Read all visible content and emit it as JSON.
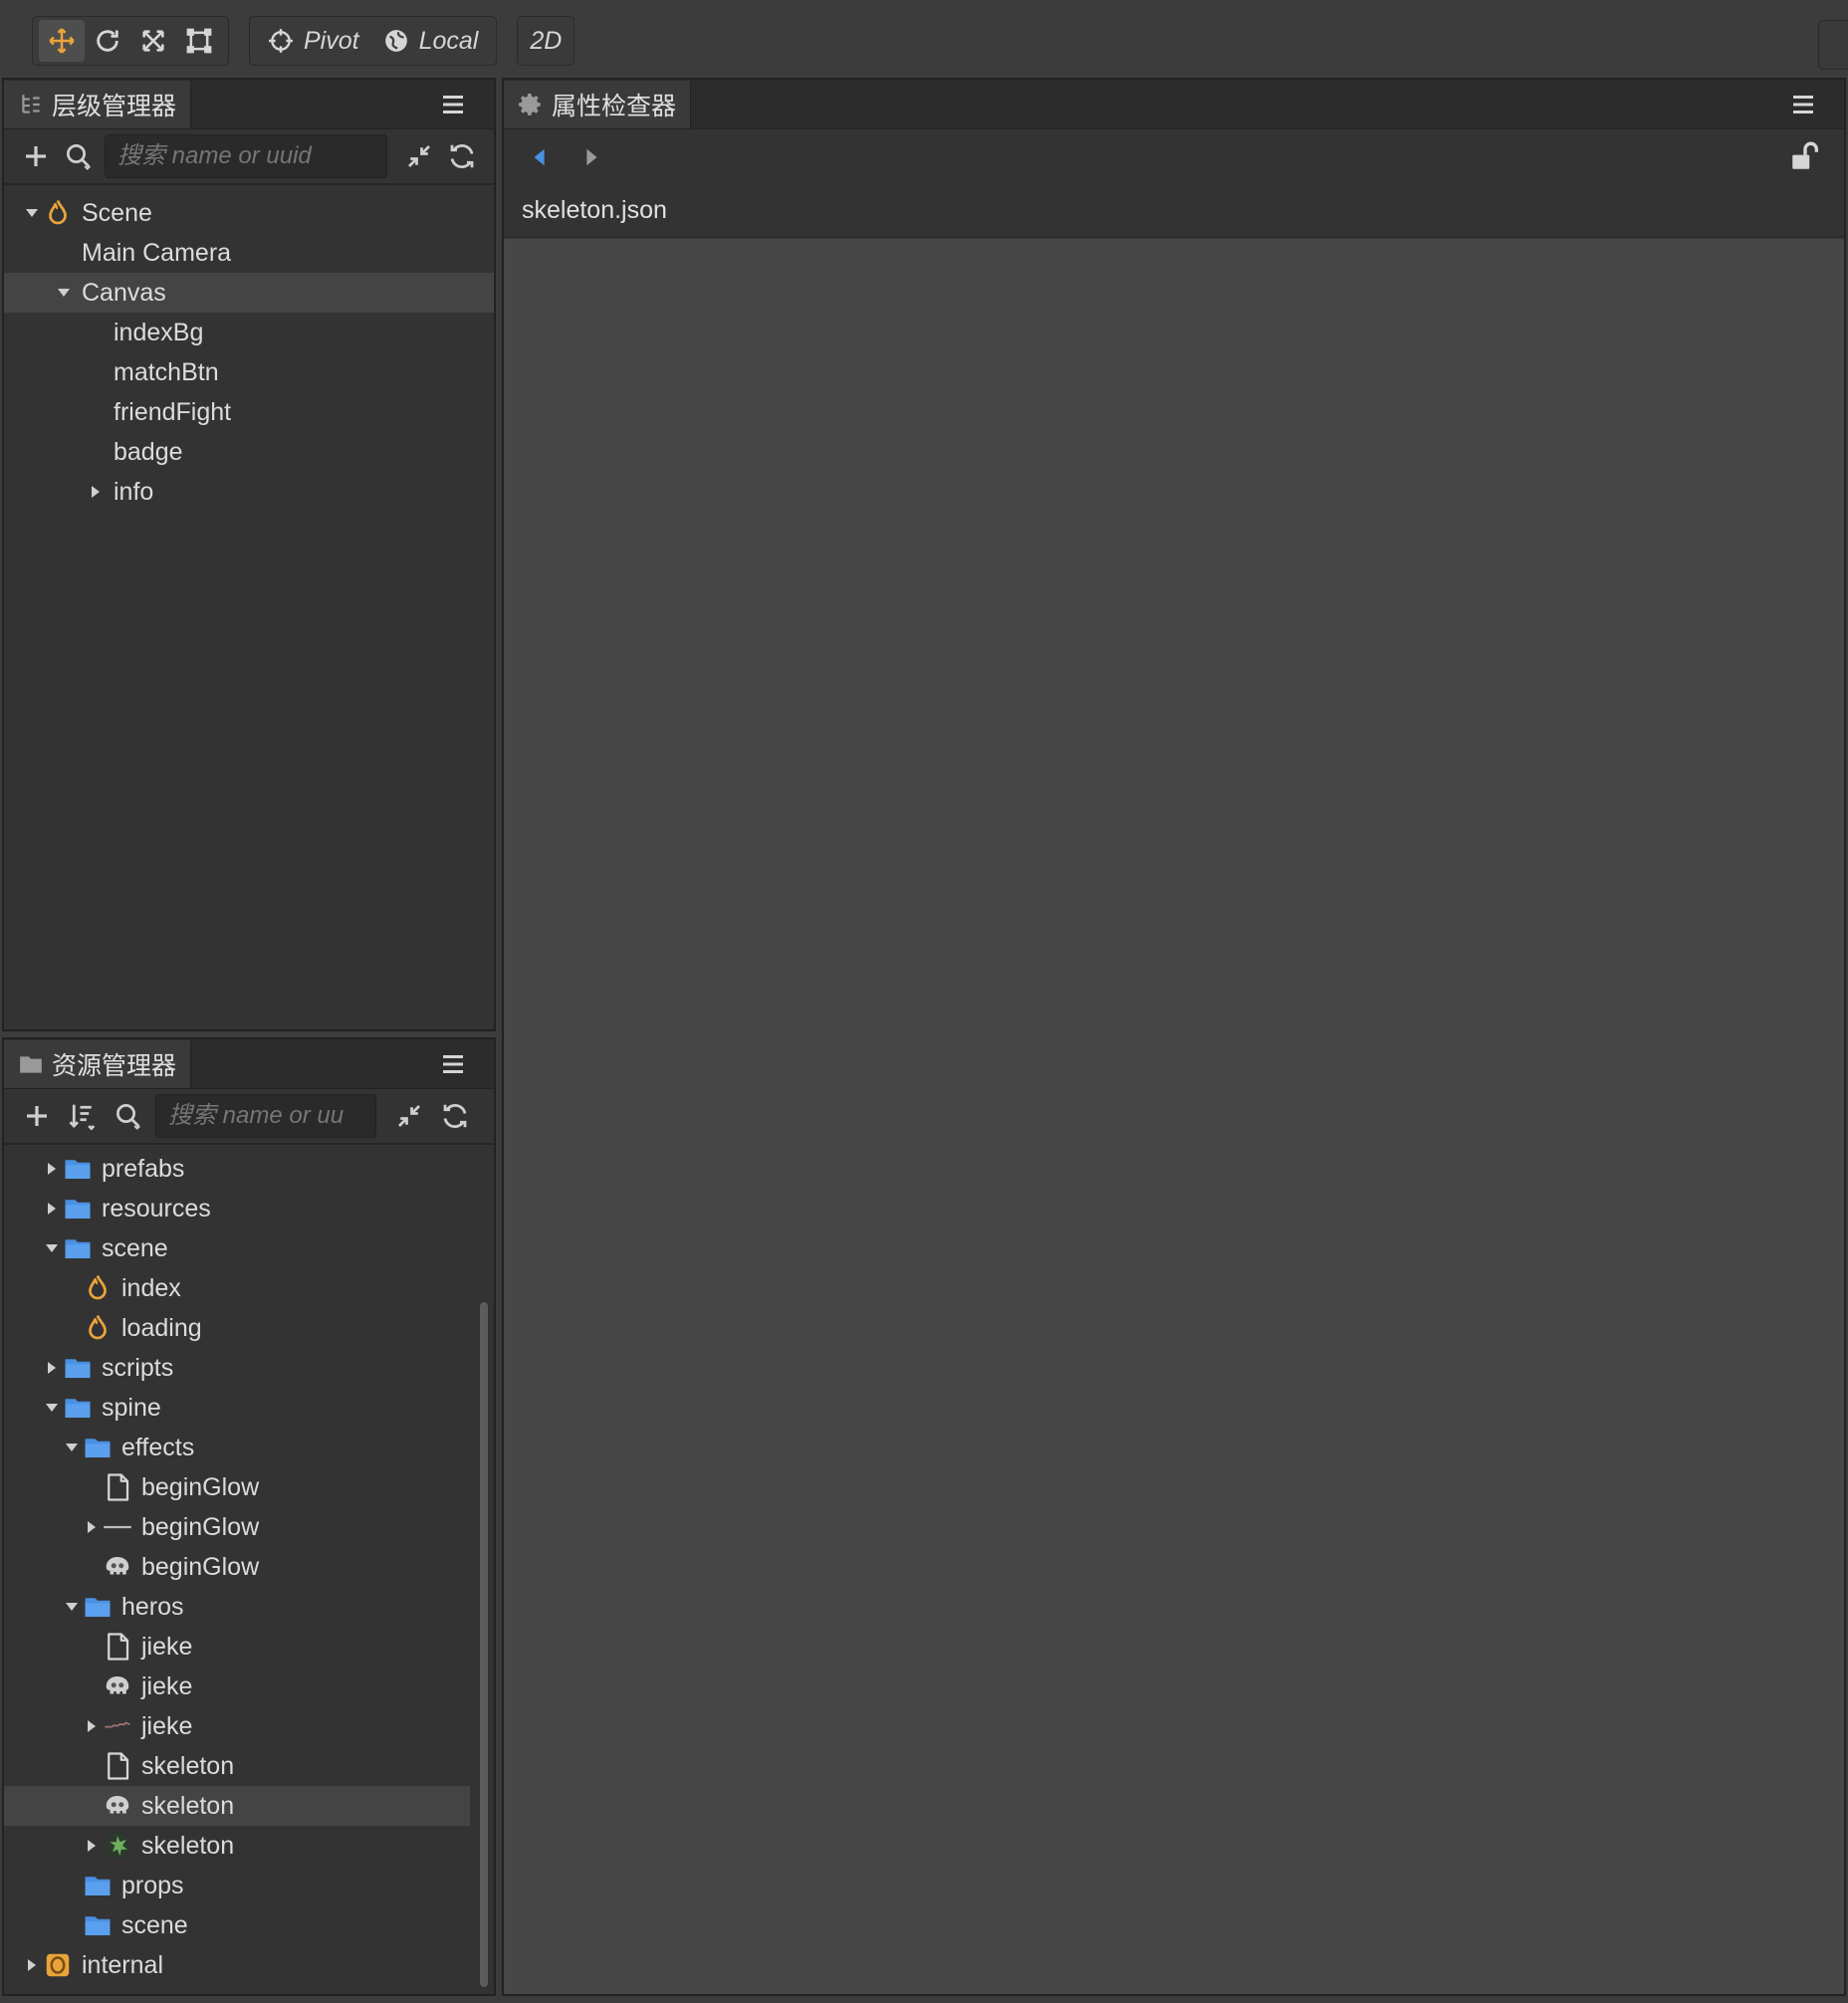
{
  "toolbar": {
    "tools": [
      "move-tool",
      "rotate-tool",
      "scale-tool",
      "rect-tool"
    ],
    "pivot_label": "Pivot",
    "local_label": "Local",
    "mode_label": "2D"
  },
  "hierarchy": {
    "title": "层级管理器",
    "search_placeholder": "搜索 name or uuid",
    "nodes": [
      {
        "label": "Scene",
        "depth": 0,
        "expanded": true,
        "icon": "scene-icon"
      },
      {
        "label": "Main Camera",
        "depth": 1
      },
      {
        "label": "Canvas",
        "depth": 1,
        "expanded": true,
        "selected": true
      },
      {
        "label": "indexBg",
        "depth": 2
      },
      {
        "label": "matchBtn",
        "depth": 2
      },
      {
        "label": "friendFight",
        "depth": 2
      },
      {
        "label": "badge",
        "depth": 2
      },
      {
        "label": "info",
        "depth": 2,
        "expanded": false
      }
    ]
  },
  "assets": {
    "title": "资源管理器",
    "search_placeholder": "搜索 name or uu",
    "nodes": [
      {
        "label": "prefabs",
        "depth": 1,
        "expanded": false,
        "icon": "folder-icon"
      },
      {
        "label": "resources",
        "depth": 1,
        "expanded": false,
        "icon": "folder-icon"
      },
      {
        "label": "scene",
        "depth": 1,
        "expanded": true,
        "icon": "folder-icon"
      },
      {
        "label": "index",
        "depth": 2,
        "icon": "scene-icon"
      },
      {
        "label": "loading",
        "depth": 2,
        "icon": "scene-icon"
      },
      {
        "label": "scripts",
        "depth": 1,
        "expanded": false,
        "icon": "folder-icon"
      },
      {
        "label": "spine",
        "depth": 1,
        "expanded": true,
        "icon": "folder-icon"
      },
      {
        "label": "effects",
        "depth": 2,
        "expanded": true,
        "icon": "folder-icon"
      },
      {
        "label": "beginGlow",
        "depth": 3,
        "icon": "file-icon"
      },
      {
        "label": "beginGlow",
        "depth": 3,
        "expanded": false,
        "icon": "atlas-line-icon"
      },
      {
        "label": "beginGlow",
        "depth": 3,
        "icon": "skeleton-icon"
      },
      {
        "label": "heros",
        "depth": 2,
        "expanded": true,
        "icon": "folder-icon"
      },
      {
        "label": "jieke",
        "depth": 3,
        "icon": "file-icon"
      },
      {
        "label": "jieke",
        "depth": 3,
        "icon": "skeleton-icon"
      },
      {
        "label": "jieke",
        "depth": 3,
        "expanded": false,
        "icon": "texture-icon"
      },
      {
        "label": "skeleton",
        "depth": 3,
        "icon": "file-icon"
      },
      {
        "label": "skeleton",
        "depth": 3,
        "icon": "skeleton-icon",
        "selected": true
      },
      {
        "label": "skeleton",
        "depth": 3,
        "expanded": false,
        "icon": "texture-green-icon"
      },
      {
        "label": "props",
        "depth": 2,
        "icon": "folder-icon"
      },
      {
        "label": "scene",
        "depth": 2,
        "icon": "folder-icon"
      },
      {
        "label": "internal",
        "depth": 0,
        "expanded": false,
        "icon": "internal-db-icon"
      }
    ]
  },
  "inspector": {
    "title": "属性检查器",
    "selected_file": "skeleton.json"
  },
  "colors": {
    "accent": "#e9a43b",
    "folder": "#4a90e2",
    "nav_back": "#4a90e2",
    "bg": "#3c3c3c",
    "panel": "#333333",
    "inspector_body": "#474747"
  }
}
